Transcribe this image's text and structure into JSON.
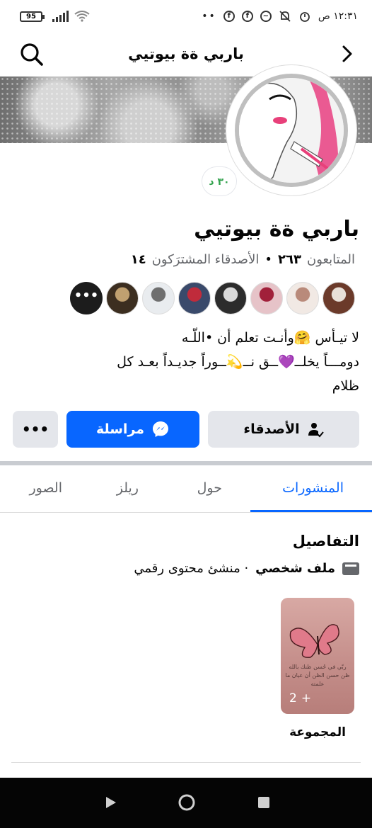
{
  "status_bar": {
    "battery": "95",
    "time": "١٢:٣١ ص",
    "notif_icons": [
      "facebook-icon",
      "facebook-icon",
      "messenger-icon",
      "mute-icon",
      "alarm-icon"
    ],
    "dots": "••"
  },
  "header": {
    "title": "باربي ةة بيوتيي"
  },
  "profile": {
    "name": "باربي ةة بيوتيي",
    "online_badge": "٣٠ د",
    "followers_label": "المتابعون",
    "followers_count": "٢٦٣",
    "separator": "•",
    "mutual_label": "الأصدقاء المشترَكون",
    "mutual_count": "١٤",
    "bio_line1": "لا تيـأس 🤗وأنـت تعلم أن •اللّـه",
    "bio_line2": "دومـــاً يخلــ💜ــق نــ💫ــوراً جديـداً بعـد كل",
    "bio_line3": "ظلام",
    "friend_avatars": [
      {
        "color": "#6b3a2a",
        "accent": "#e8e0d8"
      },
      {
        "color": "#f1e9e4",
        "accent": "#b98a7a"
      },
      {
        "color": "#e6c3c8",
        "accent": "#a1203a"
      },
      {
        "color": "#2c2c2c",
        "accent": "#d9d9d9"
      },
      {
        "color": "#3a4a6b",
        "accent": "#c02b3b"
      },
      {
        "color": "#e9ecef",
        "accent": "#6f6f6f"
      },
      {
        "color": "#3c2e20",
        "accent": "#c0a070"
      },
      {
        "color": "#1f1f1f",
        "accent": "#555555"
      }
    ],
    "friends_more": "•••"
  },
  "actions": {
    "friends_label": "الأصدقاء",
    "message_label": "مراسلة",
    "more_label": "•••"
  },
  "tabs": [
    {
      "label": "المنشورات",
      "active": true
    },
    {
      "label": "حول",
      "active": false
    },
    {
      "label": "ريلز",
      "active": false
    },
    {
      "label": "الصور",
      "active": false
    }
  ],
  "details": {
    "title": "التفاصيل",
    "type_bold": "ملف شخصي",
    "type_rest": "· منشئ محتوى رقمي"
  },
  "group": {
    "label": "المجموعة",
    "count": "2",
    "plus": "+",
    "card_text": "ربّي في حُسن ظنك بالله ظن حسن الظن أن عيان ما علمته"
  },
  "colors": {
    "accent": "#0866ff",
    "button_gray": "#e4e6eb",
    "online_green": "#31a24c"
  }
}
